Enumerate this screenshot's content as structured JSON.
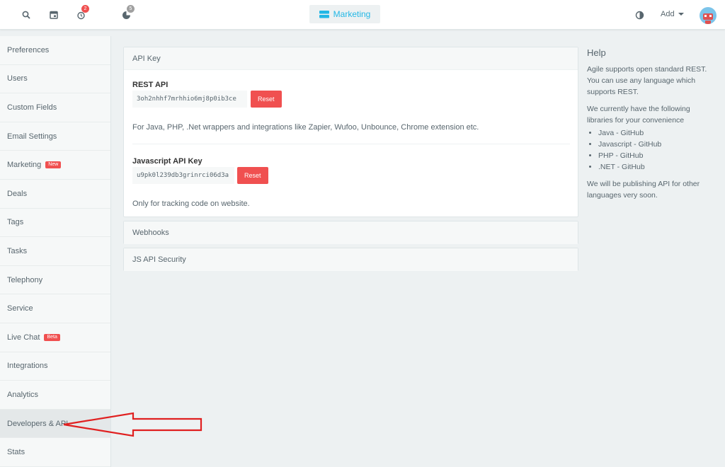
{
  "topbar": {
    "reminders_badge": "2",
    "notifications_badge": "5",
    "marketing_label": "Marketing",
    "add_label": "Add"
  },
  "sidebar": {
    "items": [
      {
        "label": "Preferences"
      },
      {
        "label": "Users"
      },
      {
        "label": "Custom Fields"
      },
      {
        "label": "Email Settings"
      },
      {
        "label": "Marketing",
        "tag": "New"
      },
      {
        "label": "Deals"
      },
      {
        "label": "Tags"
      },
      {
        "label": "Tasks"
      },
      {
        "label": "Telephony"
      },
      {
        "label": "Service"
      },
      {
        "label": "Live Chat",
        "tag": "Beta"
      },
      {
        "label": "Integrations"
      },
      {
        "label": "Analytics"
      },
      {
        "label": "Developers & API",
        "active": true
      },
      {
        "label": "Stats"
      }
    ]
  },
  "api_key_panel": {
    "title": "API Key",
    "rest_title": "REST API",
    "rest_key": "3oh2nhhf7mrhhio6mj8p0ib3ce",
    "rest_reset": "Reset",
    "rest_note": "For Java, PHP, .Net wrappers and integrations like Zapier, Wufoo, Unbounce, Chrome extension etc.",
    "js_title": "Javascript API Key",
    "js_key": "u9pk0l239db3grinrci06d3a",
    "js_reset": "Reset",
    "js_note": "Only for tracking code on website."
  },
  "webhooks_panel": {
    "title": "Webhooks"
  },
  "js_security_panel": {
    "title": "JS API Security"
  },
  "help": {
    "title": "Help",
    "p1": "Agile supports open standard REST. You can use any language which supports REST.",
    "p2": "We currently have the following libraries for your convenience",
    "libraries": [
      "Java - GitHub",
      "Javascript - GitHub",
      "PHP - GitHub",
      ".NET - GitHub"
    ],
    "p3": "We will be publishing API for other languages very soon."
  },
  "colors": {
    "accent": "#23b7e5",
    "danger": "#f05050",
    "annotation": "#e02020"
  }
}
